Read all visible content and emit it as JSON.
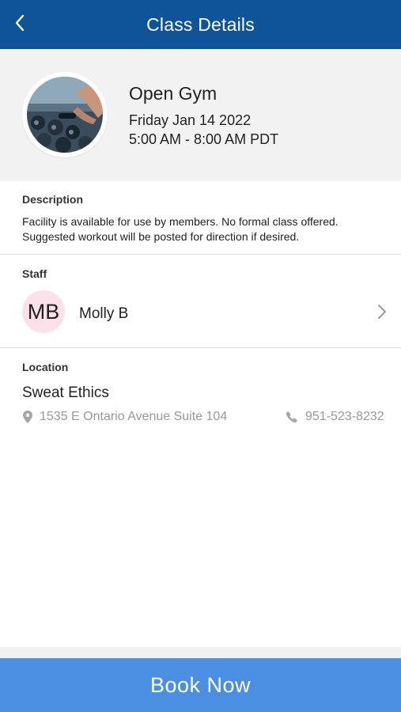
{
  "header": {
    "title": "Class Details",
    "back_icon": "chevron-left-icon"
  },
  "class_info": {
    "name": "Open Gym",
    "date": "Friday Jan 14 2022",
    "time": "5:00 AM - 8:00 AM PDT"
  },
  "description": {
    "label": "Description",
    "text": "Facility is available for use by members. No formal class offered. Suggested workout will be posted for direction if desired."
  },
  "staff": {
    "label": "Staff",
    "initials": "MB",
    "name": "Molly B",
    "avatar_color": "#fce1ea"
  },
  "location": {
    "label": "Location",
    "name": "Sweat Ethics",
    "address": "1535 E Ontario Avenue Suite 104",
    "phone": "951-523-8232"
  },
  "actions": {
    "book_label": "Book Now"
  },
  "colors": {
    "header": "#0f5399",
    "button": "#4a8fe2"
  }
}
